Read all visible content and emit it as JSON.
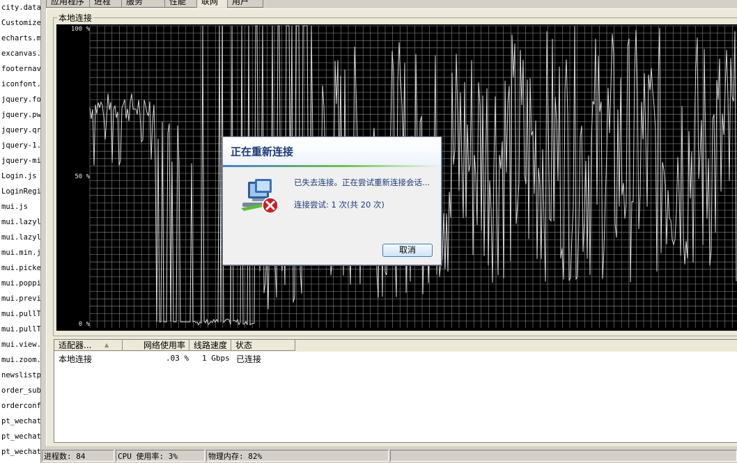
{
  "file_list": [
    "city.data",
    "Customize",
    "echarts.m",
    "excanvas.",
    "footernav.",
    "iconfont.",
    "jquery.fo",
    "jquery.pw",
    "jquery.qr",
    "jquery-1.",
    "jquery-mi",
    "Login.js",
    "LoginRegi",
    "mui.js",
    "mui.lazyl",
    "mui.lazyl",
    "mui.min.js",
    "mui.picke",
    "mui.poppi",
    "mui.previ",
    "mui.pullT",
    "mui.pullT",
    "mui.view.",
    "mui.zoom.",
    "newslistp",
    "order_sub",
    "orderconf",
    "pt_wechat",
    "pt_wechat",
    "pt_wechat"
  ],
  "tabs": [
    "应用程序",
    "进程",
    "服务",
    "性能",
    "联网",
    "用户"
  ],
  "active_tab": "联网",
  "group_label": "本地连接",
  "graph": {
    "y_labels": [
      "100 %",
      "50 %",
      "0 %"
    ],
    "line_color": "#d8d8d8",
    "grid_color": "#cfcfcf"
  },
  "table": {
    "headers": [
      "适配器...",
      "网络使用率",
      "线路速度",
      "状态"
    ],
    "sort_arrow": "▲",
    "rows": [
      {
        "adapter": "本地连接",
        "usage": ".03 %",
        "speed": "1 Gbps",
        "state": "已连接"
      }
    ]
  },
  "status_bar": {
    "processes": "进程数: 84",
    "cpu": "CPU 使用率: 3%",
    "memory": "物理内存: 82%"
  },
  "dialog": {
    "title": "正在重新连接",
    "message": "已失去连接。正在尝试重新连接会话...",
    "attempt": "连接尝试: 1 次(共 20 次)",
    "cancel_label": "取消",
    "icon": "network-error-icon"
  }
}
